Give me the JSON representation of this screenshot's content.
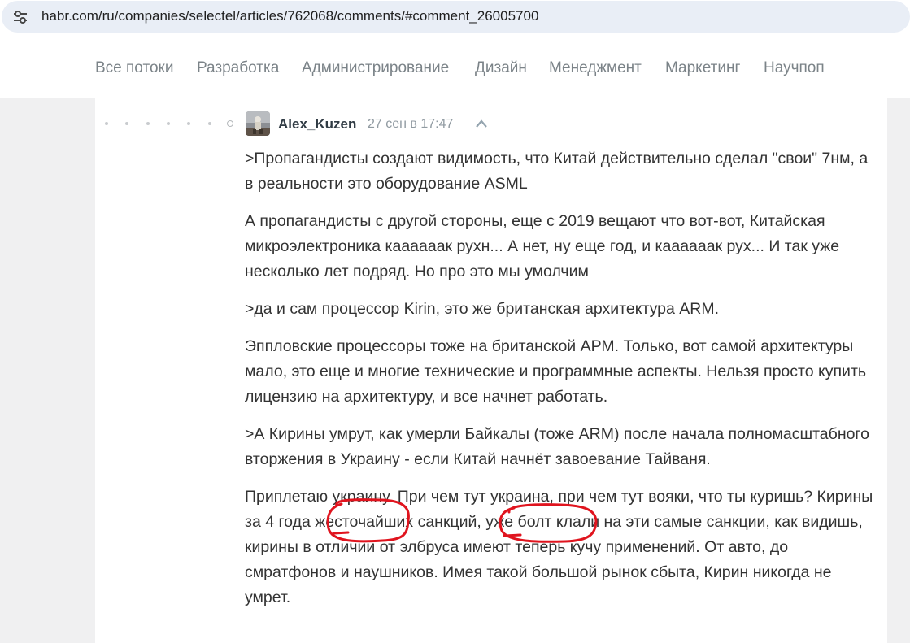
{
  "browser": {
    "url": "habr.com/ru/companies/selectel/articles/762068/comments/#comment_26005700",
    "site_info_icon": "tune-icon"
  },
  "nav": {
    "items": [
      "Все потоки",
      "Разработка",
      "Администрирование",
      "Дизайн",
      "Менеджмент",
      "Маркетинг",
      "Научпоп"
    ]
  },
  "comment": {
    "author": "Alex_Kuzen",
    "time": "27 сен в 17:47",
    "collapse_icon": "chevron-up-icon",
    "paragraphs": [
      ">Пропагандисты создают видимость, что Китай действительно сделал \"свои\" 7нм, а в реальности это оборудование ASML",
      "А пропагандисты с другой стороны, еще с 2019 вещают что вот-вот, Китайская микроэлектроника каааааак рухн... А нет, ну еще год, и каааааак рух... И так уже несколько лет подряд. Но про это мы умолчим",
      ">да и сам процессор Kirin, это же британская архитектура ARM.",
      "Эппловские процессоры тоже на британской АРМ. Только, вот самой архитектуры мало, это еще и многие технические и программные аспекты. Нельзя просто купить лицензию на архитектуру, и все начнет работать.",
      ">А Кирины умрут, как умерли Байкалы (тоже ARM) после начала полномасштабного вторжения в Украину - если Китай начнёт завоевание Тайваня.",
      "Приплетаю украину. При чем тут украина, при чем тут вояки, что ты куришь? Кирины за 4 года жесточайших санкций, уже болт клали на эти самые санкции, как видишь, кирины в отличии от элбруса имеют теперь кучу применений. От авто, до смратфонов и наушников. Имея такой большой рынок сбыта, Кирин никогда не умрет."
    ]
  },
  "colors": {
    "nav_text": "#7b8388",
    "annotation": "#e0141e",
    "page_bg": "#f0f0f1"
  }
}
